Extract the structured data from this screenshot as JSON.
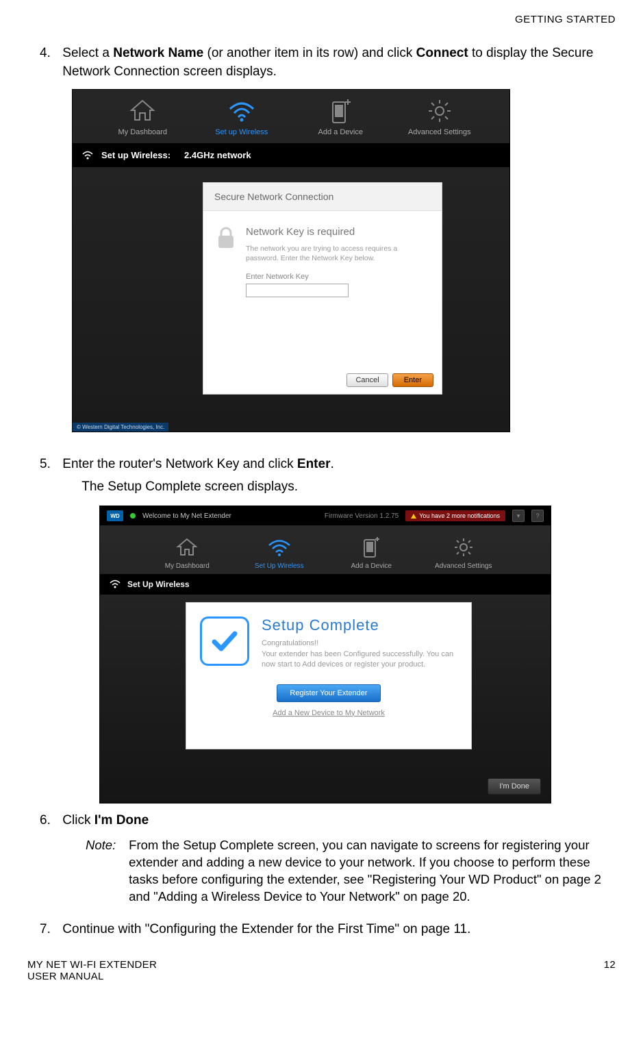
{
  "header": {
    "section": "GETTING STARTED"
  },
  "step4": {
    "num": "4.",
    "text_a": "Select a ",
    "text_b": "Network Name",
    "text_c": " (or another item in its row) and click ",
    "text_d": "Connect",
    "text_e": " to display the Secure Network Connection screen displays."
  },
  "shot1": {
    "nav": {
      "dash": "My Dashboard",
      "wireless": "Set up Wireless",
      "adddev": "Add a Device",
      "adv": "Advanced Settings"
    },
    "bar_label": "Set up Wireless:",
    "bar_net": "2.4GHz network",
    "panel": {
      "title": "Secure Network Connection",
      "heading": "Network Key is required",
      "desc": "The network you are trying to access requires a password. Enter the Network Key below.",
      "label": "Enter Network Key",
      "cancel": "Cancel",
      "enter": "Enter"
    },
    "copyright": "© Western Digital Technologies, Inc."
  },
  "step5": {
    "num": "5.",
    "line1a": "Enter the router's Network Key and click ",
    "line1b": "Enter",
    "line1c": ".",
    "line2": "The Setup Complete screen displays."
  },
  "shot2": {
    "top": {
      "welcome": "Welcome to My Net Extender",
      "fw": "Firmware Version 1.2.75",
      "notif": "You have 2 more notifications",
      "help": "?"
    },
    "nav": {
      "dash": "My Dashboard",
      "wireless": "Set Up Wireless",
      "adddev": "Add a Device",
      "adv": "Advanced Settings"
    },
    "bar": "Set Up Wireless",
    "panel": {
      "title": "Setup  Complete",
      "congrats": "Congratulations!!",
      "body": "Your extender has been Configured successfully.  You can now start to Add devices or register your product.",
      "register": "Register Your  Extender",
      "addlink": "Add a New Device to My Network"
    },
    "done": "I'm Done"
  },
  "step6": {
    "num": "6.",
    "text_a": "Click ",
    "text_b": "I'm Done"
  },
  "note": {
    "label": "Note:",
    "body": "From the Setup Complete screen, you can navigate to screens for registering your extender and adding a new device to your network. If you choose to perform these tasks before configuring the extender, see \"Registering Your WD Product\" on page 2 and \"Adding a Wireless Device to Your Network\" on page 20."
  },
  "step7": {
    "num": "7.",
    "text": "Continue with \"Configuring the Extender for the First Time\" on page 11."
  },
  "footer": {
    "left1": "MY NET WI-FI EXTENDER",
    "left2": "USER MANUAL",
    "page": "12"
  }
}
